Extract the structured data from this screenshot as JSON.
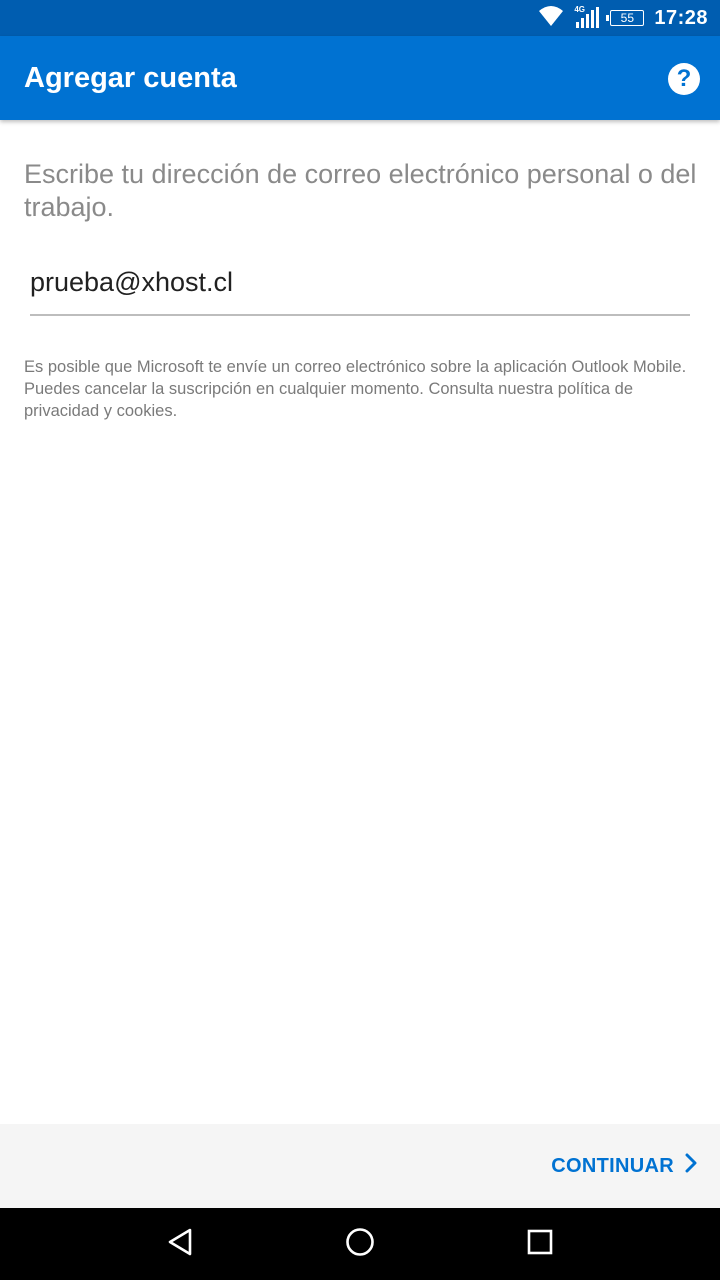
{
  "status_bar": {
    "network_label": "4G",
    "battery": "55",
    "time": "17:28"
  },
  "app_bar": {
    "title": "Agregar cuenta",
    "help_icon": "help-circle-icon"
  },
  "main": {
    "prompt": "Escribe tu dirección de correo electrónico personal o del trabajo.",
    "email_value": "prueba@xhost.cl",
    "disclaimer": "Es posible que Microsoft te envíe un correo electrónico sobre la aplicación Outlook Mobile. Puedes cancelar la suscripción en cualquier momento. Consulta nuestra política de privacidad y cookies."
  },
  "footer": {
    "continue_label": "CONTINUAR",
    "continue_icon": "chevron-right-icon"
  },
  "nav_bar": {
    "back_icon": "back-triangle-icon",
    "home_icon": "home-circle-icon",
    "recents_icon": "recents-square-icon"
  },
  "colors": {
    "status_bar": "#005DB0",
    "app_bar": "#0072D2",
    "accent": "#0072D2",
    "prompt_text": "#8a8a8a",
    "footer_bg": "#f5f5f5",
    "nav_bar": "#000000"
  }
}
